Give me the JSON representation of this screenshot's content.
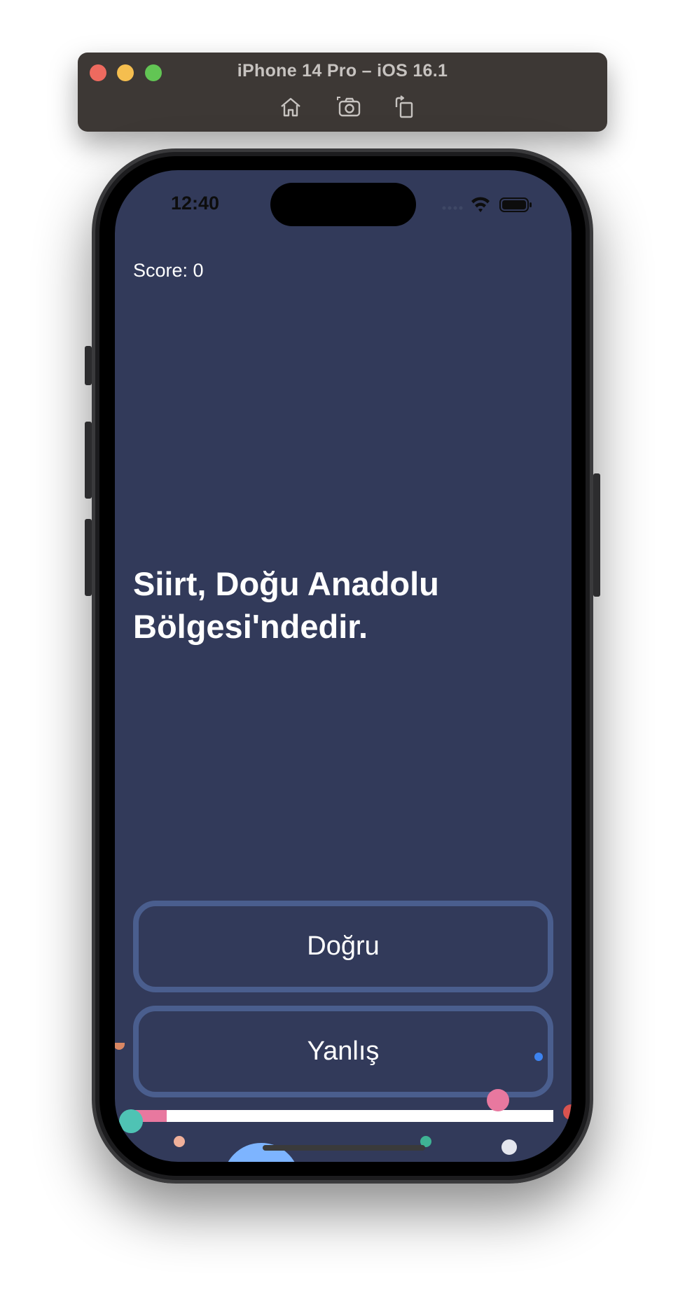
{
  "simulator": {
    "title": "iPhone 14 Pro – iOS 16.1",
    "tools": [
      {
        "icon": "home-icon"
      },
      {
        "icon": "camera-icon"
      },
      {
        "icon": "rotate-icon"
      }
    ]
  },
  "status_bar": {
    "time": "12:40",
    "icons": [
      "cellular-icon",
      "wifi-icon",
      "battery-icon"
    ]
  },
  "quiz": {
    "score_label": "Score: 0",
    "question": "Siirt, Doğu Anadolu Bölgesi'ndedir.",
    "true_label": "Doğru",
    "false_label": "Yanlış",
    "progress": 0.08
  },
  "colors": {
    "background": "#323a5a",
    "button_border": "#4a5e8e",
    "progress_fill": "#e8789f",
    "progress_track": "#ffffff"
  }
}
